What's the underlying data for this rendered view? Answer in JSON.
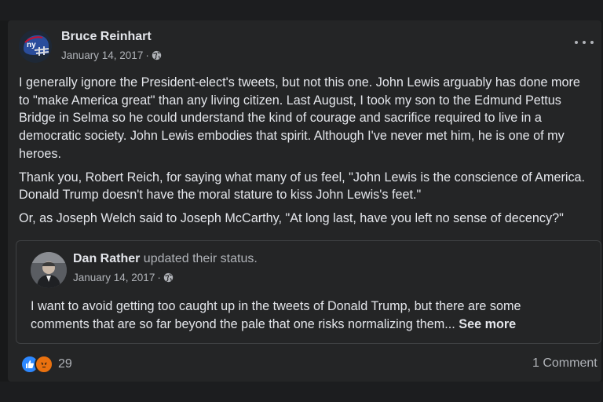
{
  "post": {
    "author": "Bruce Reinhart",
    "date": "January 14, 2017",
    "meta_separator": "·",
    "privacy_icon": "globe-icon",
    "more_icon": "more-options-icon",
    "paragraphs": [
      "I generally ignore the President-elect's tweets, but not this one. John Lewis arguably has done more to \"make America great\" than any living citizen. Last August, I took my son to the Edmund Pettus Bridge in Selma so he could understand the kind of courage and sacrifice required to live in a democratic society.  John Lewis embodies that spirit. Although I've never met him, he is one of my heroes.",
      "Thank you, Robert Reich, for saying what many of us feel, \"John Lewis is the conscience of America. Donald Trump doesn't have the moral stature to kiss John Lewis's feet.\"",
      "Or, as Joseph Welch said to Joseph McCarthy, \"At long last, have you left no sense of decency?\""
    ]
  },
  "shared_post": {
    "author": "Dan Rather",
    "action": " updated their status.",
    "date": "January 14, 2017",
    "meta_separator": "·",
    "privacy_icon": "globe-icon",
    "text": "I want to avoid getting too caught up in the tweets of Donald Trump, but there are some comments that are so far beyond the pale that one risks normalizing them... ",
    "see_more": "See more"
  },
  "engagement": {
    "reaction_icons": [
      "like-icon",
      "angry-icon"
    ],
    "reaction_count": "29",
    "comments": "1 Comment"
  },
  "colors": {
    "background": "#18191a",
    "card": "#242526",
    "primary_text": "#e4e6eb",
    "secondary_text": "#b0b3b8",
    "like_blue": "#2d88ff",
    "angry_orange": "#e9710f"
  }
}
